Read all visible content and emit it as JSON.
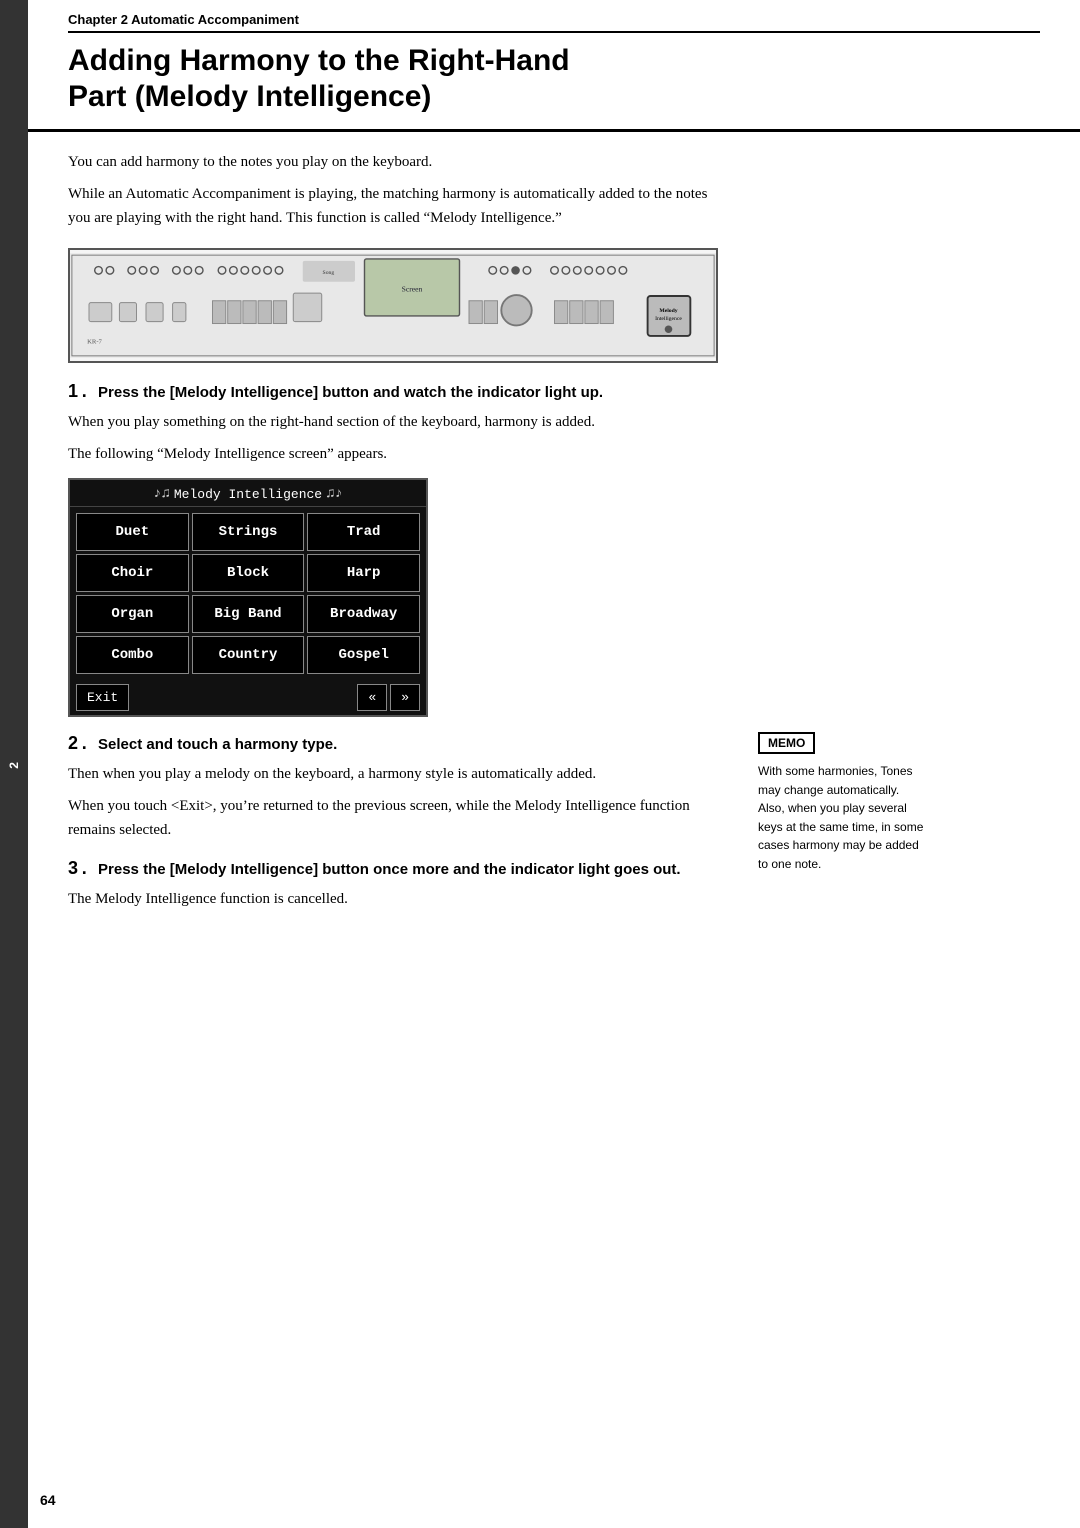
{
  "chapter": {
    "number": "2",
    "title": "Chapter 2  Automatic Accompaniment"
  },
  "page_title": {
    "line1": "Adding Harmony to the Right-Hand",
    "line2": "Part (Melody Intelligence)"
  },
  "intro": {
    "para1": "You can add harmony to the notes you play on the keyboard.",
    "para2": "While an Automatic Accompaniment is playing, the matching harmony is automatically added to the notes you are playing with the right hand. This function is called “Melody Intelligence.”"
  },
  "keyboard_label": "Melody Intelligence button highlighted",
  "steps": [
    {
      "number": "1",
      "title": "Press the [Melody Intelligence] button and watch the indicator light up.",
      "body1": "When you play something on the right-hand section of the keyboard, harmony is added.",
      "body2": "The following “Melody Intelligence screen” appears."
    },
    {
      "number": "2",
      "title": "Select and touch a harmony type.",
      "body1": "Then when you play a melody on the keyboard, a harmony style is automatically added.",
      "body2": "When you touch <Exit>, you’re returned to the previous screen, while the Melody Intelligence function remains selected."
    },
    {
      "number": "3",
      "title": "Press the [Melody Intelligence] button once more and the indicator light goes out.",
      "sub_bold": "goes out.",
      "body1": "The Melody Intelligence function is cancelled."
    }
  ],
  "melody_screen": {
    "header": "Melody Intelligence",
    "buttons": [
      "Duet",
      "Strings",
      "Trad",
      "Choir",
      "Block",
      "Harp",
      "Organ",
      "Big Band",
      "Broadway",
      "Combo",
      "Country",
      "Gospel"
    ],
    "exit_label": "Exit",
    "prev_label": "«",
    "next_label": "»"
  },
  "memo": {
    "title": "MEMO",
    "lines": [
      "With some harmonies, Tones",
      "may change automatically.",
      "Also, when you play several",
      "keys at the same time, in some",
      "cases harmony may be added",
      "to one note."
    ]
  },
  "page_number": "64",
  "chapter_tab": "Chapter 2"
}
